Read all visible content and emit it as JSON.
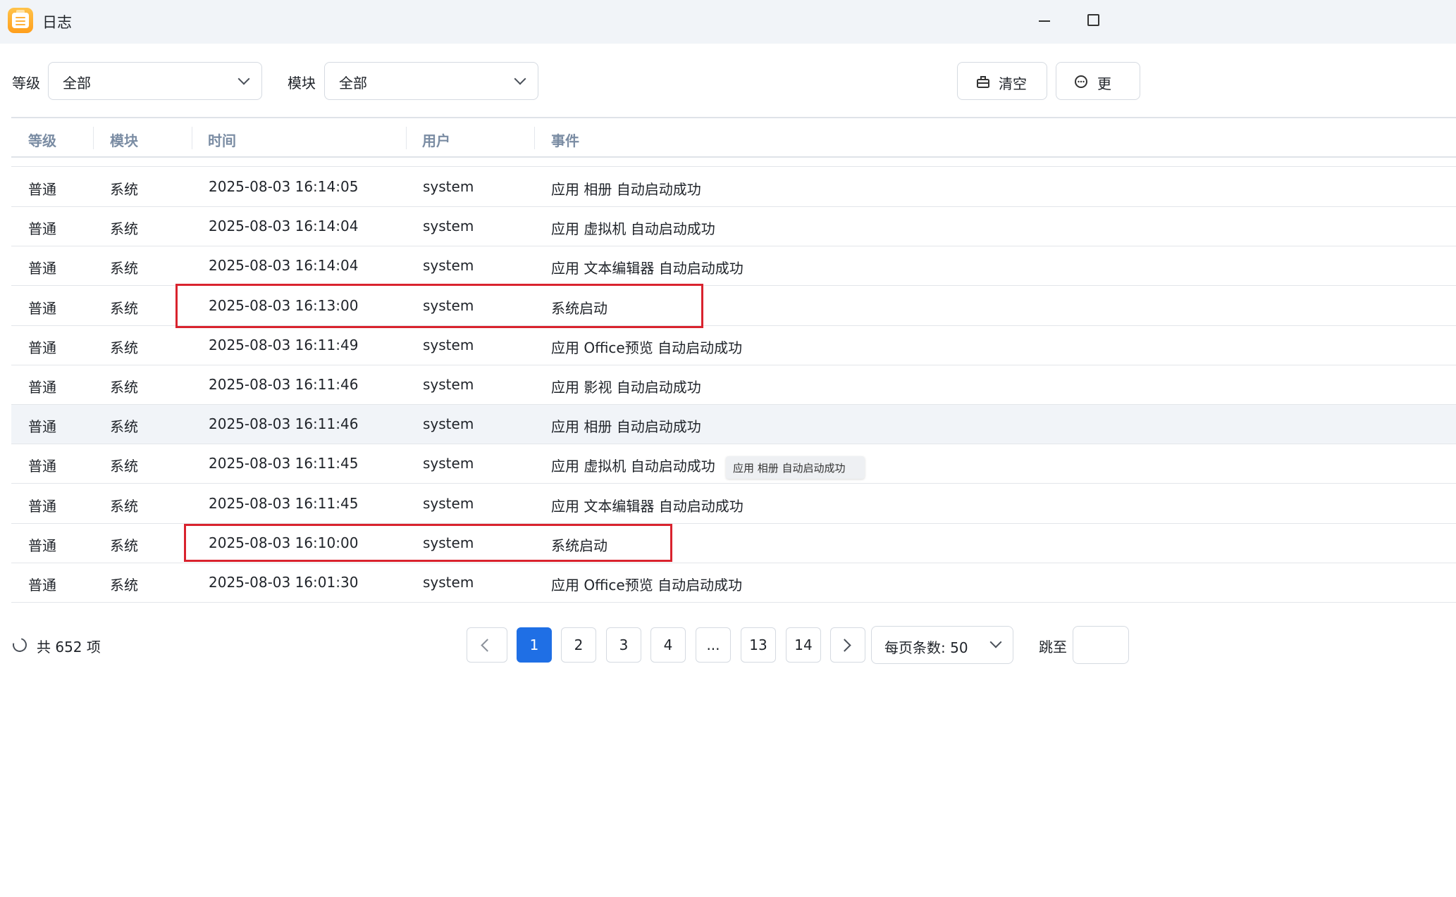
{
  "window": {
    "title": "日志"
  },
  "filters": {
    "level_label": "等级",
    "level_value": "全部",
    "module_label": "模块",
    "module_value": "全部"
  },
  "toolbar": {
    "clear_label": "清空",
    "more_label": "更"
  },
  "table": {
    "columns": [
      "等级",
      "模块",
      "时间",
      "用户",
      "事件"
    ],
    "rows": [
      [
        "普通",
        "系统",
        "2025-08-03 16:14:05",
        "system",
        "应用 相册 自动启动成功"
      ],
      [
        "普通",
        "系统",
        "2025-08-03 16:14:04",
        "system",
        "应用 虚拟机 自动启动成功"
      ],
      [
        "普通",
        "系统",
        "2025-08-03 16:14:04",
        "system",
        "应用 文本编辑器 自动启动成功"
      ],
      [
        "普通",
        "系统",
        "2025-08-03 16:13:00",
        "system",
        "系统启动"
      ],
      [
        "普通",
        "系统",
        "2025-08-03 16:11:49",
        "system",
        "应用 Office预览 自动启动成功"
      ],
      [
        "普通",
        "系统",
        "2025-08-03 16:11:46",
        "system",
        "应用 影视 自动启动成功"
      ],
      [
        "普通",
        "系统",
        "2025-08-03 16:11:46",
        "system",
        "应用 相册 自动启动成功"
      ],
      [
        "普通",
        "系统",
        "2025-08-03 16:11:45",
        "system",
        "应用 虚拟机 自动启动成功"
      ],
      [
        "普通",
        "系统",
        "2025-08-03 16:11:45",
        "system",
        "应用 文本编辑器 自动启动成功"
      ],
      [
        "普通",
        "系统",
        "2025-08-03 16:10:00",
        "system",
        "系统启动"
      ],
      [
        "普通",
        "系统",
        "2025-08-03 16:01:30",
        "system",
        "应用 Office预览 自动启动成功"
      ]
    ],
    "tooltip": "应用 相册 自动启动成功"
  },
  "footer": {
    "total": "共 652 项",
    "pages": [
      "1",
      "2",
      "3",
      "4",
      "...",
      "13",
      "14"
    ],
    "active_page": "1",
    "page_size_label": "每页条数: 50",
    "jump_label": "跳至"
  },
  "colors": {
    "accent": "#1f6fe5",
    "highlight": "#d9232e",
    "header_text": "#7a8ca3"
  }
}
